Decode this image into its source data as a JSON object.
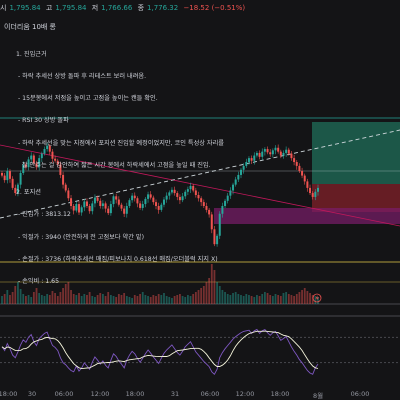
{
  "header": {
    "open_label": "시",
    "open_value": "1,795.84",
    "high_label": "고",
    "high_value": "1,795.84",
    "low_label": "저",
    "low_value": "1,766.66",
    "close_label": "종",
    "close_value": "1,776.32",
    "change": "−18.52 (−0.51%)"
  },
  "title": "이더리움 10배 롱",
  "notes": {
    "l1": "1. 진입근거",
    "l2": " - 하락 추세선 상방 돌파 후 리테스트 보러 내려옴.",
    "l3": " - 15분봉에서 저점을 높이고 고점을 높이는 캔들 확인.",
    "l4": " - RSI 30 상방 돌파",
    "l5": " - 하락 추세선을 맞는 지점에서 포지션 진입할 예정이었지만, 코인 특성상 자리를",
    "l6": "   잘 안주는 걸 감안하여 짧은 시간 봉에서 하락세에서 고점을 높일 때 진입.",
    "l7": "2. 포지션",
    "l8": " - 진입가 : 3813.12",
    "l9": " - 익절가 : 3940 (안전하게 전 고점보다 약간 밑)",
    "l10": " - 손절가 : 3736 (하락추세선 매집/피보나치 0.618선 매집/오더블럭 지지 X)",
    "l11": " - 손익비 : 1.65"
  },
  "colors": {
    "up": "#26a69a",
    "down": "#ef5350",
    "background": "#141416",
    "take_profit_zone": "#1f6e5a",
    "stop_loss_zone": "#7a1f28",
    "order_block": "#7b1d6b",
    "trendline": "#c2185b",
    "dashed_trendline": "#cfd8dc",
    "fib_line": "#e6c84a",
    "rsi_line": "#f5f5dc"
  },
  "icons": {
    "alert": "lightning-icon"
  },
  "chart_data": {
    "type": "candlestick",
    "x_ticks": [
      "18:00",
      "30",
      "06:00",
      "12:00",
      "18:00",
      "31",
      "06:00",
      "12:00",
      "18:00",
      "8월",
      "06:00"
    ],
    "grid": false,
    "series": {
      "close": [
        1795,
        1788,
        1802,
        1790,
        1776,
        1768,
        1781,
        1799,
        1812,
        1808,
        1820,
        1826,
        1814,
        1808,
        1822,
        1829,
        1836,
        1841,
        1832,
        1821,
        1818,
        1812,
        1796,
        1781,
        1772,
        1760,
        1748,
        1741,
        1751,
        1738,
        1746,
        1755,
        1748,
        1740,
        1752,
        1761,
        1756,
        1748,
        1752,
        1744,
        1737,
        1751,
        1763,
        1758,
        1750,
        1744,
        1736,
        1748,
        1757,
        1764,
        1760,
        1752,
        1745,
        1751,
        1759,
        1766,
        1761,
        1754,
        1748,
        1742,
        1750,
        1758,
        1764,
        1769,
        1773,
        1768,
        1762,
        1757,
        1763,
        1770,
        1774,
        1779,
        1772,
        1765,
        1760,
        1754,
        1748,
        1742,
        1735,
        1712,
        1689,
        1702,
        1736,
        1748,
        1756,
        1764,
        1772,
        1781,
        1789,
        1796,
        1804,
        1810,
        1816,
        1822,
        1818,
        1826,
        1830,
        1824,
        1832,
        1836,
        1831,
        1828,
        1834,
        1838,
        1832,
        1826,
        1830,
        1835,
        1829,
        1822,
        1816,
        1810,
        1802,
        1795,
        1786,
        1776,
        1768,
        1762,
        1770,
        1776
      ],
      "rsi": [
        55,
        49,
        60,
        52,
        42,
        38,
        47,
        58,
        66,
        62,
        70,
        74,
        63,
        57,
        68,
        72,
        76,
        78,
        67,
        57,
        54,
        49,
        38,
        30,
        27,
        22,
        18,
        16,
        25,
        17,
        22,
        30,
        25,
        20,
        31,
        39,
        34,
        28,
        33,
        26,
        22,
        34,
        44,
        40,
        33,
        28,
        22,
        34,
        42,
        48,
        44,
        37,
        31,
        37,
        44,
        50,
        45,
        39,
        34,
        29,
        37,
        45,
        50,
        54,
        58,
        52,
        46,
        42,
        48,
        55,
        59,
        63,
        55,
        47,
        42,
        37,
        32,
        28,
        24,
        16,
        12,
        20,
        38,
        46,
        52,
        57,
        62,
        67,
        71,
        74,
        77,
        79,
        80,
        81,
        76,
        80,
        82,
        76,
        80,
        82,
        77,
        73,
        77,
        79,
        72,
        65,
        68,
        71,
        63,
        55,
        48,
        42,
        35,
        30,
        24,
        18,
        14,
        12,
        22,
        28
      ]
    },
    "levels": {
      "entry": 3813.12,
      "take_profit": 3940,
      "stop_loss": 3736,
      "risk_reward": 1.65
    }
  }
}
